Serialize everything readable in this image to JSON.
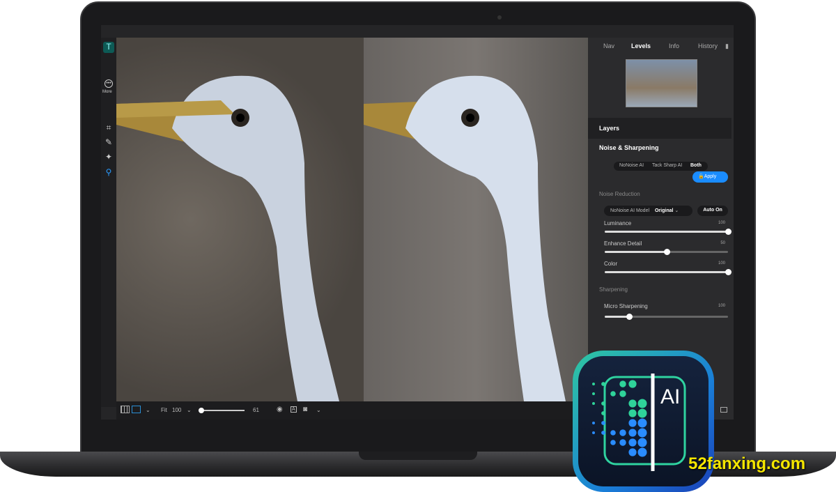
{
  "toolbar": {
    "more_label": "More"
  },
  "panel": {
    "tabs": [
      "Nav",
      "Levels",
      "Info",
      "History"
    ],
    "active_tab": "Levels",
    "layers": "Layers",
    "noise_sharpening": "Noise & Sharpening",
    "modes": [
      "NoNoise AI",
      "Tack Sharp AI",
      "Both"
    ],
    "active_mode": "Both",
    "apply": "Apply",
    "noise_reduction": "Noise Reduction",
    "model_label": "NoNoise AI Model",
    "model_value": "Original",
    "auto_on": "Auto On",
    "sliders": [
      {
        "label": "Luminance",
        "value": "100",
        "fraction": 1.0
      },
      {
        "label": "Enhance Detail",
        "value": "50",
        "fraction": 0.5
      },
      {
        "label": "Color",
        "value": "100",
        "fraction": 1.0
      }
    ],
    "sharpening": "Sharpening",
    "micro": {
      "label": "Micro Sharpening",
      "value": "100",
      "fraction": 0.2
    }
  },
  "bottombar": {
    "fit": "Fit",
    "zoom": "100",
    "slider_value": "61"
  },
  "logo": {
    "text": "AI"
  },
  "watermark": "52fanxing.com",
  "colors": {
    "accent": "#1a8cff",
    "watermark": "#f5e600"
  }
}
